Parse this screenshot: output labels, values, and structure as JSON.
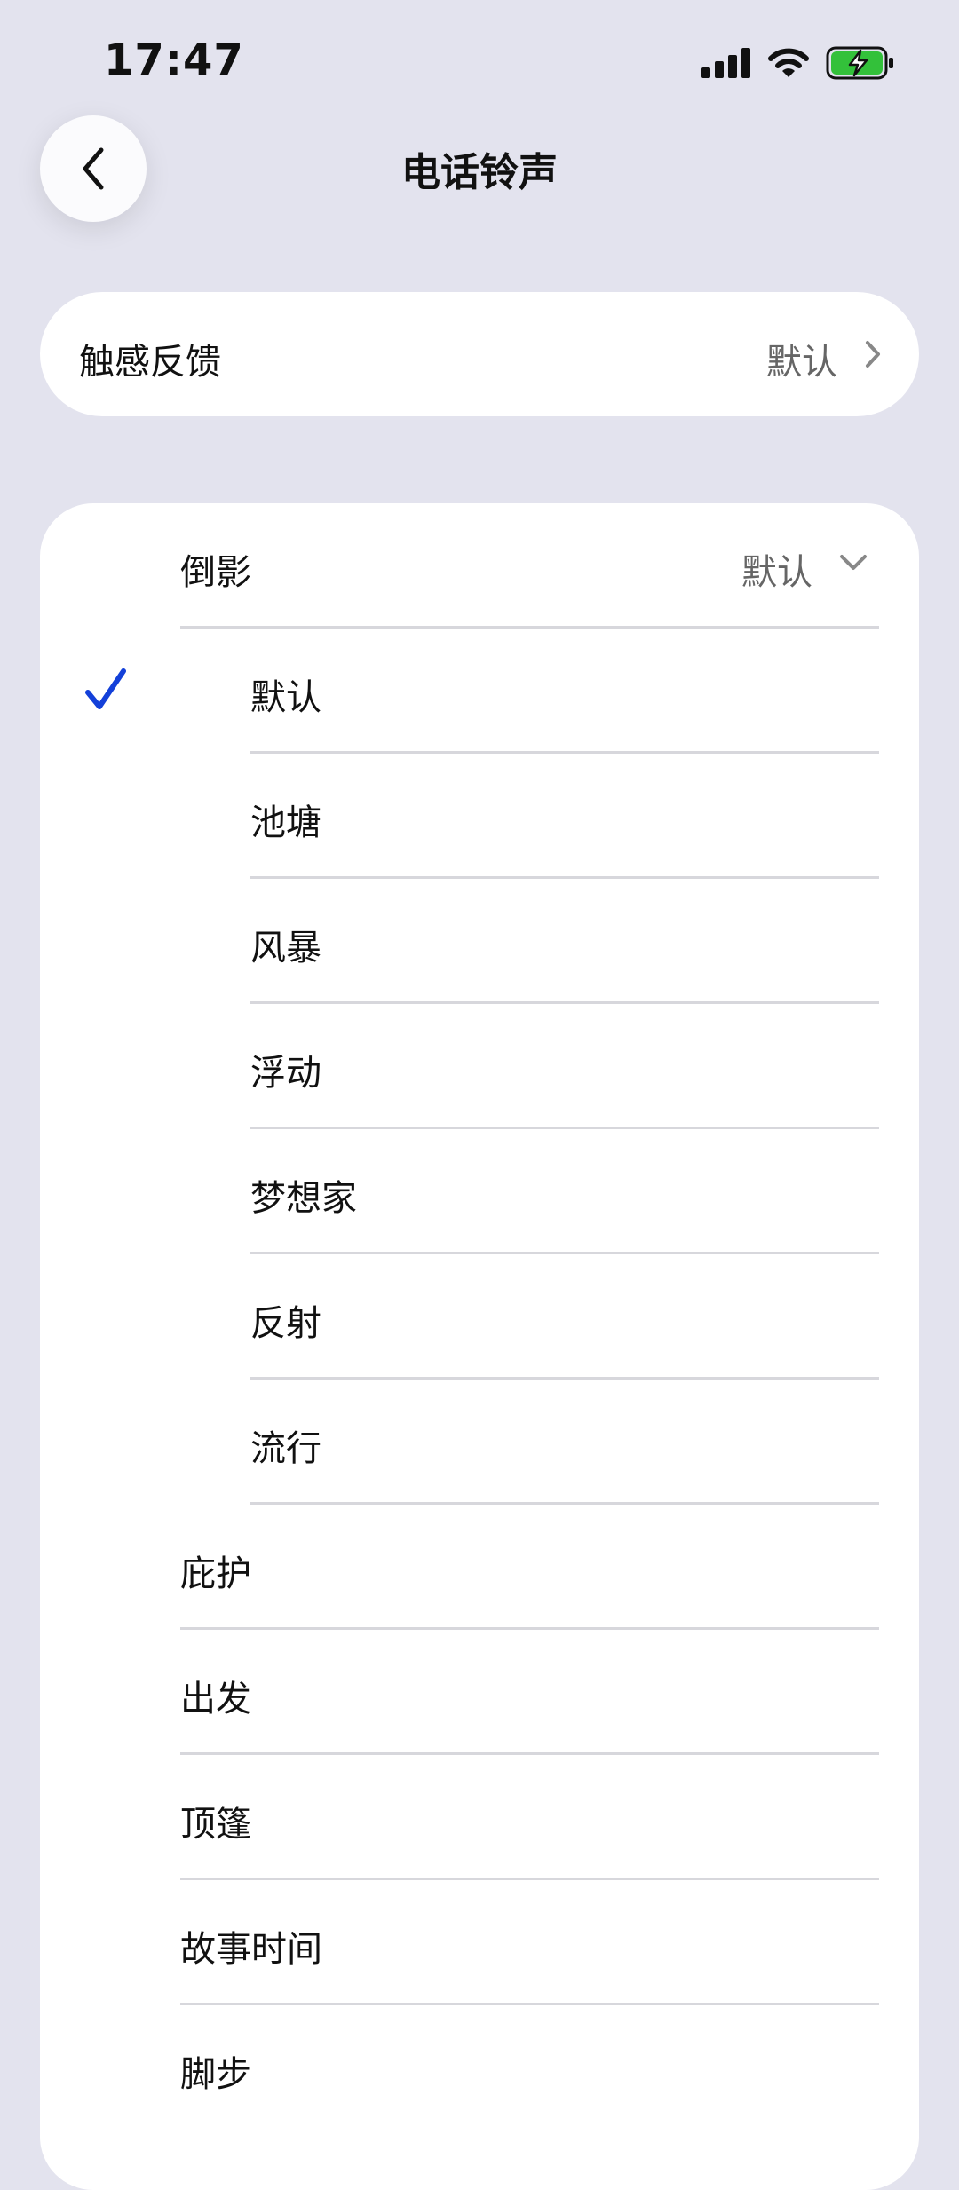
{
  "status": {
    "time": "17:47"
  },
  "header": {
    "title": "电话铃声"
  },
  "haptics": {
    "label": "触感反馈",
    "value": "默认"
  },
  "group": {
    "label": "倒影",
    "value": "默认",
    "items": [
      "默认",
      "池塘",
      "风暴",
      "浮动",
      "梦想家",
      "反射",
      "流行"
    ],
    "selected_index": 0
  },
  "tones": [
    "庇护",
    "出发",
    "顶篷",
    "故事时间",
    "脚步"
  ],
  "colors": {
    "accent": "#1340d9",
    "background": "#e3e3ee",
    "battery": "#33c13a"
  }
}
